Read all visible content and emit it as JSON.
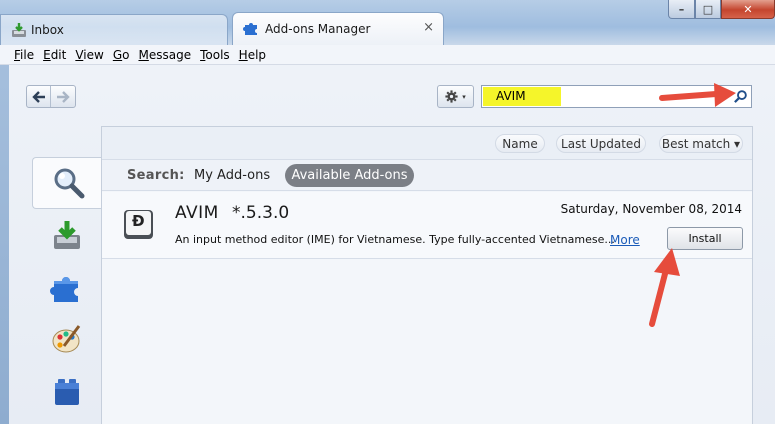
{
  "tabs": [
    {
      "label": "Inbox",
      "icon": "inbox-tray-icon",
      "active": false
    },
    {
      "label": "Add-ons Manager",
      "icon": "puzzle-piece-icon",
      "active": true,
      "close": "×"
    }
  ],
  "window_controls": {
    "minimize": "–",
    "maximize": "□",
    "close": "✕"
  },
  "menu": [
    {
      "label": "File",
      "key": "F",
      "rest": "ile"
    },
    {
      "label": "Edit",
      "key": "E",
      "rest": "dit"
    },
    {
      "label": "View",
      "key": "V",
      "rest": "iew"
    },
    {
      "label": "Go",
      "key": "G",
      "rest": "o"
    },
    {
      "label": "Message",
      "key": "M",
      "rest": "essage"
    },
    {
      "label": "Tools",
      "key": "T",
      "rest": "ools"
    },
    {
      "label": "Help",
      "key": "H",
      "rest": "elp"
    }
  ],
  "toolbar": {
    "back": "🡐",
    "forward": "🡒",
    "gear_caret": "▾"
  },
  "search": {
    "value": "AVIM",
    "highlight_color": "#f5f52a"
  },
  "sort": {
    "name": "Name",
    "last_updated": "Last Updated",
    "best_match": "Best match ▾"
  },
  "search_scope": {
    "label": "Search:",
    "my_addons": "My Add-ons",
    "available": "Available Add-ons"
  },
  "result": {
    "icon_letter": "Đ",
    "name": "AVIM",
    "version": "*.5.3.0",
    "date": "Saturday, November 08, 2014",
    "description": "An input method editor (IME) for Vietnamese. Type fully-accented Vietnamese...",
    "more": "More",
    "install": "Install"
  },
  "categories": [
    {
      "icon": "search-magnifier-icon",
      "selected": true
    },
    {
      "icon": "get-addons-download-icon",
      "selected": false
    },
    {
      "icon": "extensions-puzzle-icon",
      "selected": false
    },
    {
      "icon": "appearance-palette-icon",
      "selected": false
    },
    {
      "icon": "plugins-lego-icon",
      "selected": false
    }
  ],
  "colors": {
    "annotation_arrow": "#e64c3c",
    "active_pill": "#7b7f86",
    "link": "#1a5bb8"
  }
}
